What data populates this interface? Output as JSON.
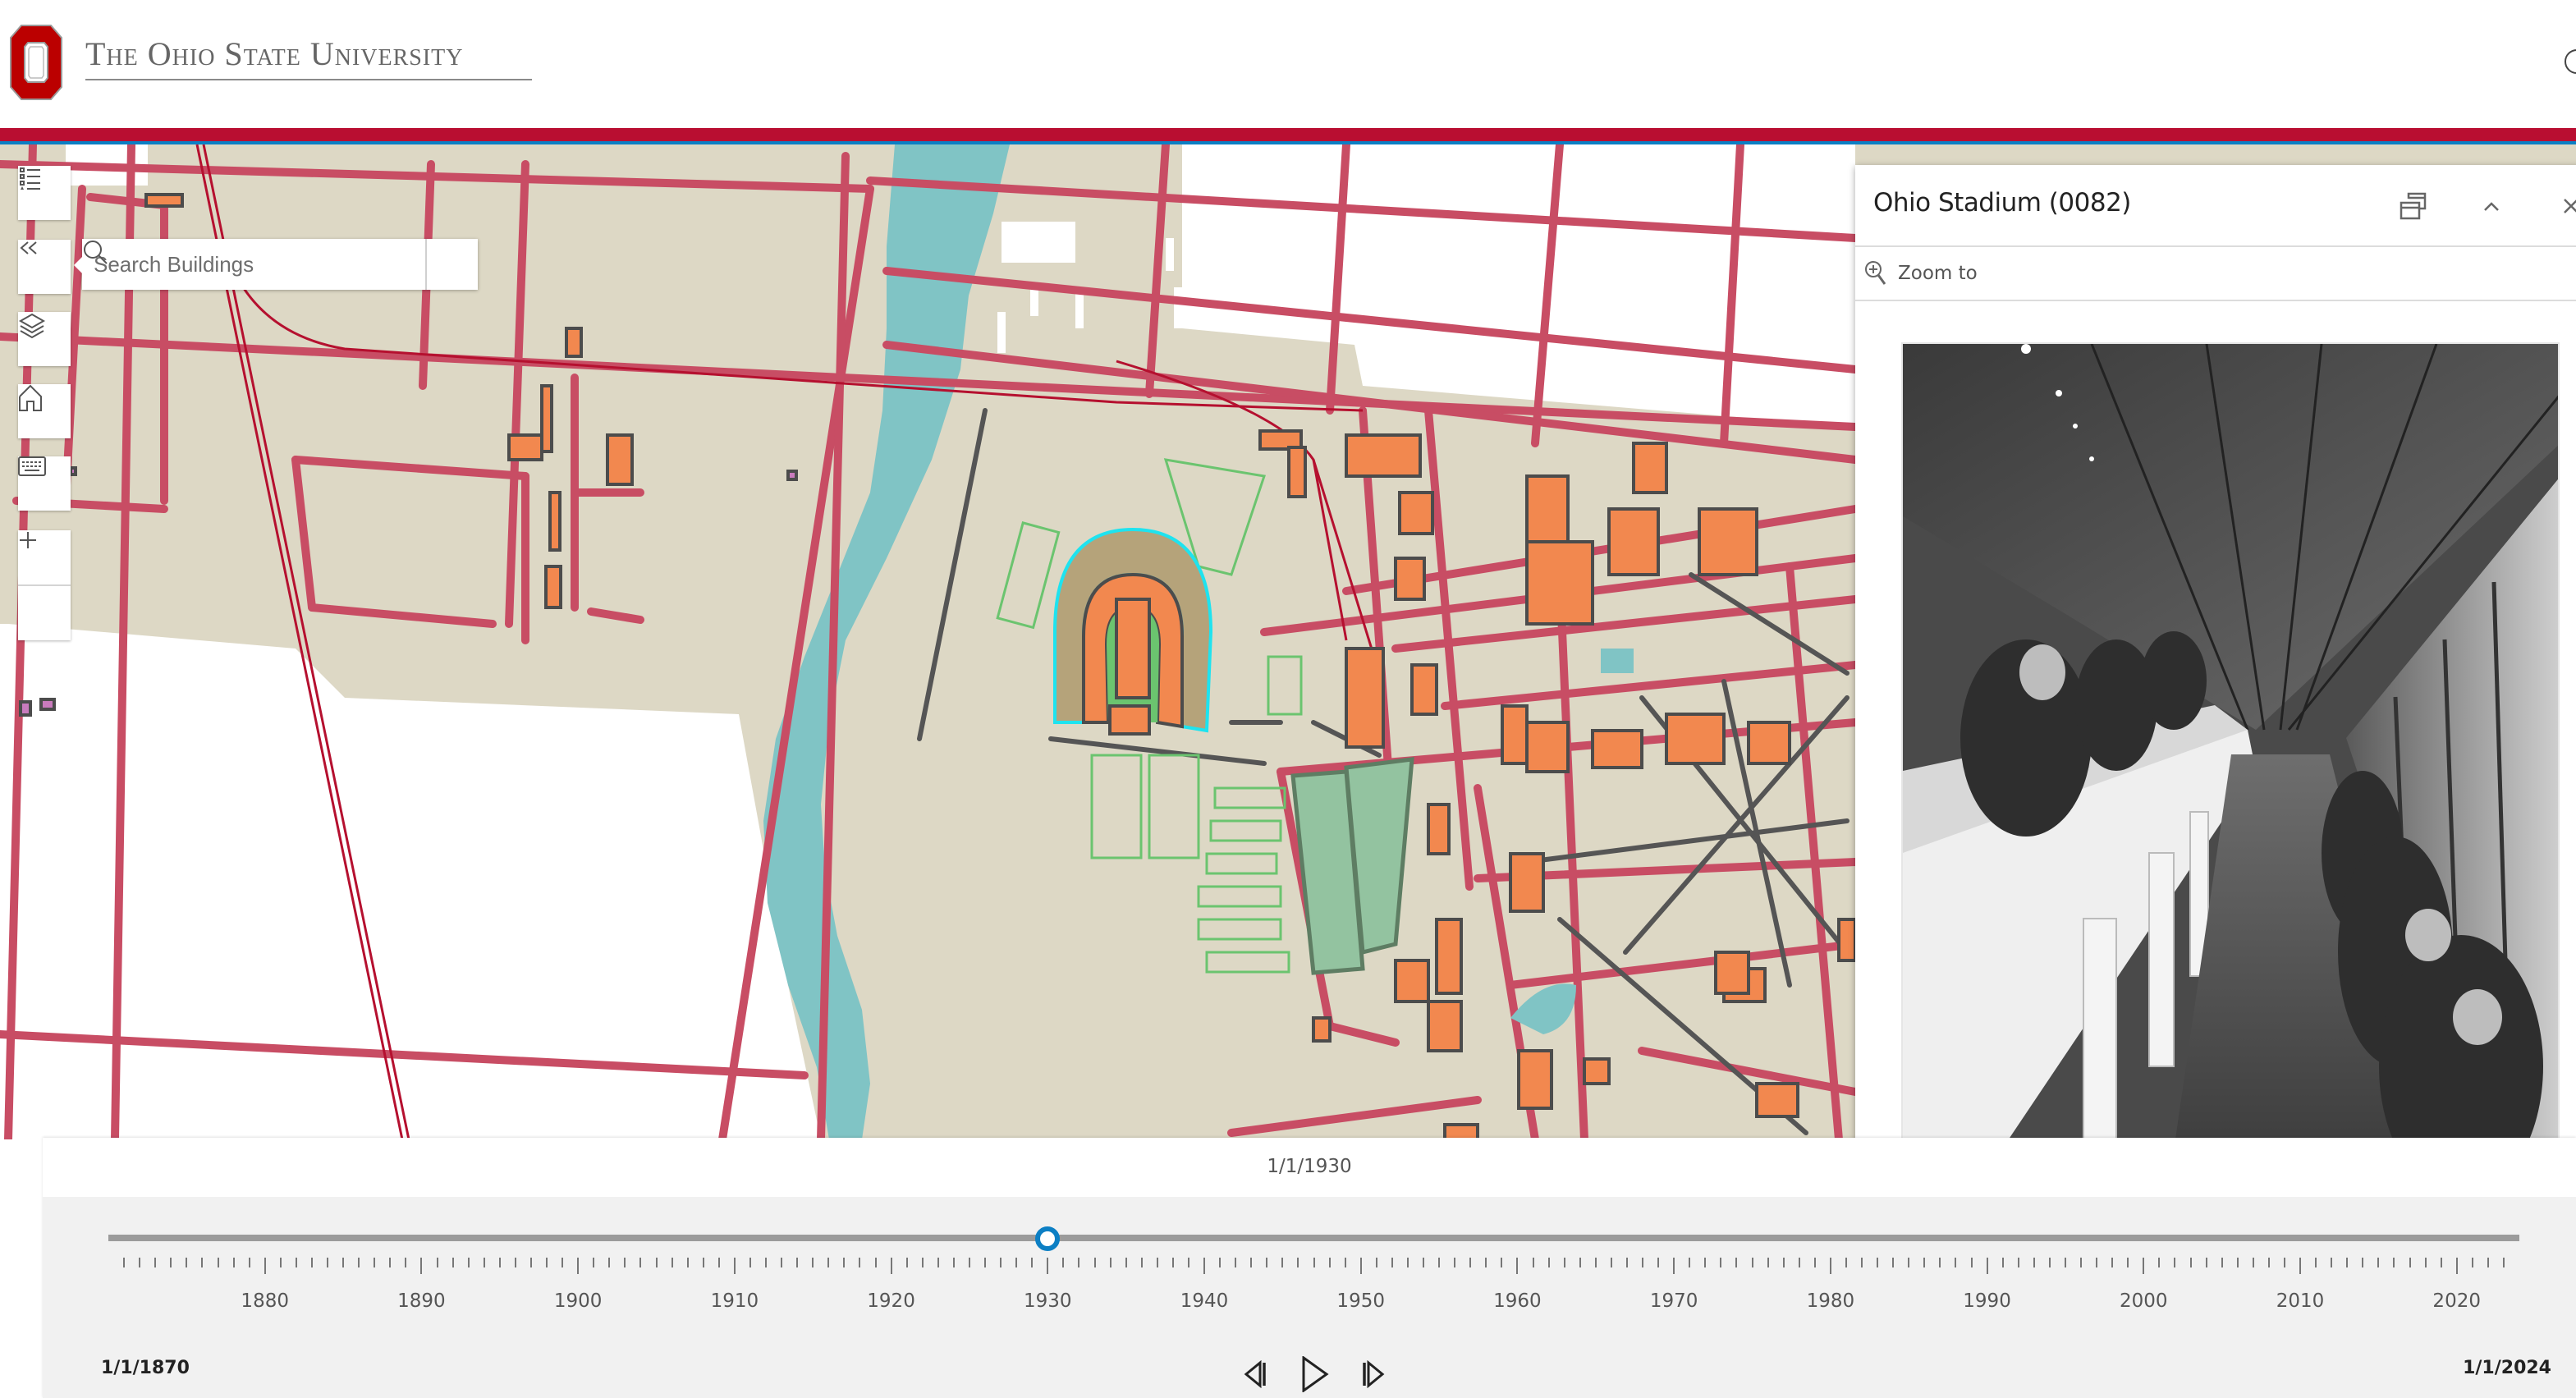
{
  "header": {
    "university_name": "The Ohio State University",
    "logo_icon": "block-o-logo",
    "search_icon": "search-icon"
  },
  "map": {
    "colors": {
      "land": "#ddd8c5",
      "road": "#c84d64",
      "railroad": "#b5102f",
      "building_fill": "#f2884f",
      "building_outline": "#4c4c4c",
      "green_space": "#93c3a0",
      "athletic_outline": "#6bc46f",
      "water": "#80c4c5",
      "stadium_stands": "#b5a37a",
      "highlight": "#1ee3ef",
      "special_building": "#c97bbd"
    },
    "selected_feature": "Ohio Stadium"
  },
  "toolbar": {
    "legend_label": "Legend",
    "collapse_label": "Collapse search",
    "layers_label": "Layers",
    "home_label": "Default extent",
    "keyboard_label": "Keyboard navigation",
    "zoom_in_label": "+",
    "zoom_out_label": "−"
  },
  "search": {
    "placeholder": "Search Buildings",
    "value": ""
  },
  "popup": {
    "title": "Ohio Stadium (0082)",
    "zoom_to_label": "Zoom to",
    "dock_tooltip": "Dock",
    "collapse_tooltip": "Collapse",
    "close_tooltip": "Close",
    "image_alt": "Black and white photo of the Ohio Stadium press box with reporters at long desks"
  },
  "timeline": {
    "current_date": "1/1/1930",
    "current_year": 1930,
    "start_label": "1/1/1870",
    "end_label": "1/1/2024",
    "start_year": 1870,
    "end_year": 2024,
    "tick_labels": [
      "1880",
      "1890",
      "1900",
      "1910",
      "1920",
      "1930",
      "1940",
      "1950",
      "1960",
      "1970",
      "1980",
      "1990",
      "2000",
      "2010",
      "2020"
    ],
    "previous_label": "Previous",
    "play_label": "Play",
    "next_label": "Next"
  }
}
